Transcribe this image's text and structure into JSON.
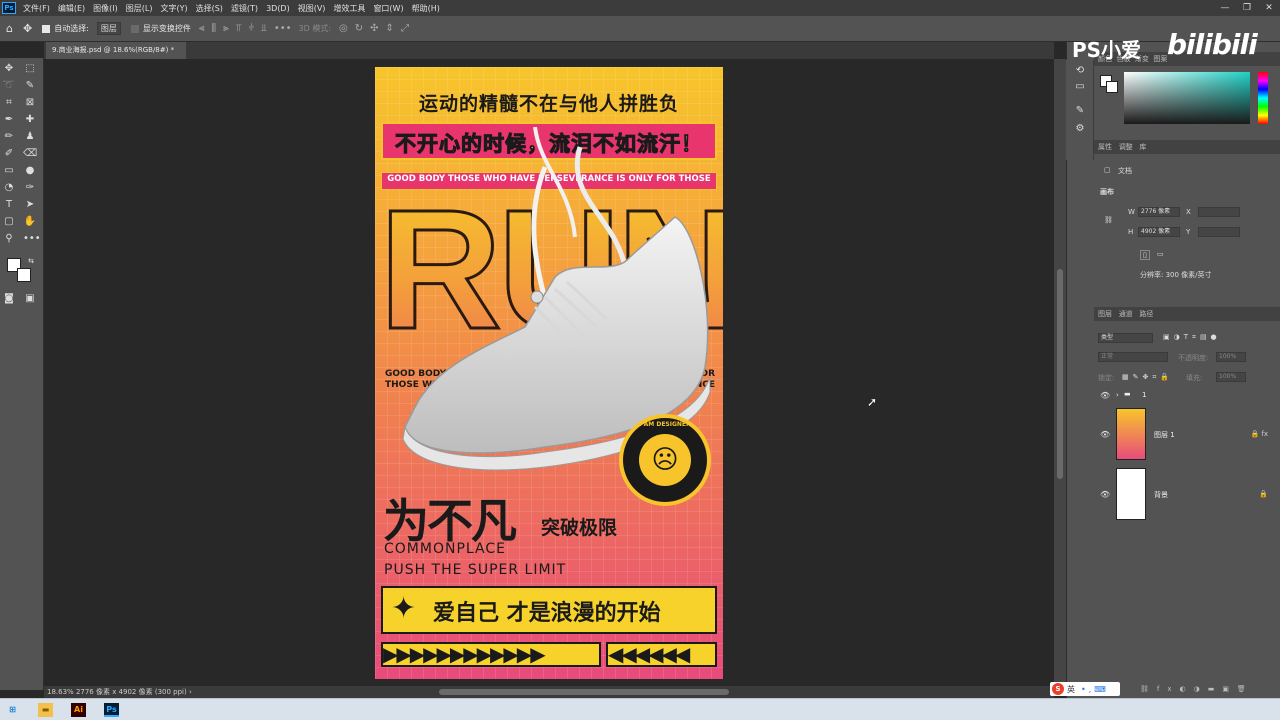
{
  "menu": {
    "items": [
      "文件(F)",
      "编辑(E)",
      "图像(I)",
      "图层(L)",
      "文字(Y)",
      "选择(S)",
      "滤镜(T)",
      "3D(D)",
      "视图(V)",
      "增效工具",
      "窗口(W)",
      "帮助(H)"
    ]
  },
  "options": {
    "auto_select_label": "自动选择:",
    "auto_select_value": "图层",
    "show_transform_label": "显示变换控件",
    "mode_3d": "3D 模式:"
  },
  "document": {
    "tab_title": "9.商业海报.psd @ 18.6%(RGB/8#) *",
    "status_zoom": "18.63%",
    "status_size": "2776 像素 x 4902 像素 (300 ppi)"
  },
  "watermark": {
    "ps": "PS小爱",
    "site": "bilibili"
  },
  "panels": {
    "color_tabs": [
      "颜色",
      "色板",
      "渐变",
      "图案"
    ],
    "properties_tabs": [
      "属性",
      "调整",
      "库"
    ],
    "doc_label": "文档",
    "canvas_label": "画布",
    "width_label": "W",
    "width_value": "2776 像素",
    "x_label": "X",
    "height_label": "H",
    "height_value": "4902 像素",
    "y_label": "Y",
    "resolution": "分辨率: 300 像素/英寸",
    "layers_tabs": [
      "图层",
      "通道",
      "路径"
    ],
    "filter_kind": "类型",
    "blend_mode": "正常",
    "opacity_label": "不透明度:",
    "opacity_value": "100%",
    "lock_label": "锁定:",
    "fill_label": "填充:",
    "fill_value": "100%"
  },
  "layers": [
    {
      "name": "1",
      "type": "group"
    },
    {
      "name": "图层 1",
      "type": "smart-object"
    },
    {
      "name": "背景",
      "type": "background"
    }
  ],
  "poster": {
    "line1": "运动的精髓不在与他人拼胜负",
    "line2": "不开心的时候，流泪不如流汗！",
    "line3": "GOOD BODY THOSE WHO HAVE PERSEVERANCE IS ONLY FOR THOSE",
    "run": "RUN",
    "small_left": "GOOD BODY I\nTHOSE WH",
    "small_right": "FOR\nERANCE",
    "badge_ring": "I AM DESIGNER",
    "big": "为不凡",
    "big2": "突破极限",
    "eng1": "COMMONPLACE",
    "eng2": "PUSH THE SUPER LIMIT",
    "slogan": "爱自己  才是浪漫的开始",
    "chev_left": "▶▶▶▶▶▶▶▶▶▶▶▶",
    "chev_right": "◀◀◀◀◀◀"
  },
  "ime": {
    "label": "英"
  }
}
